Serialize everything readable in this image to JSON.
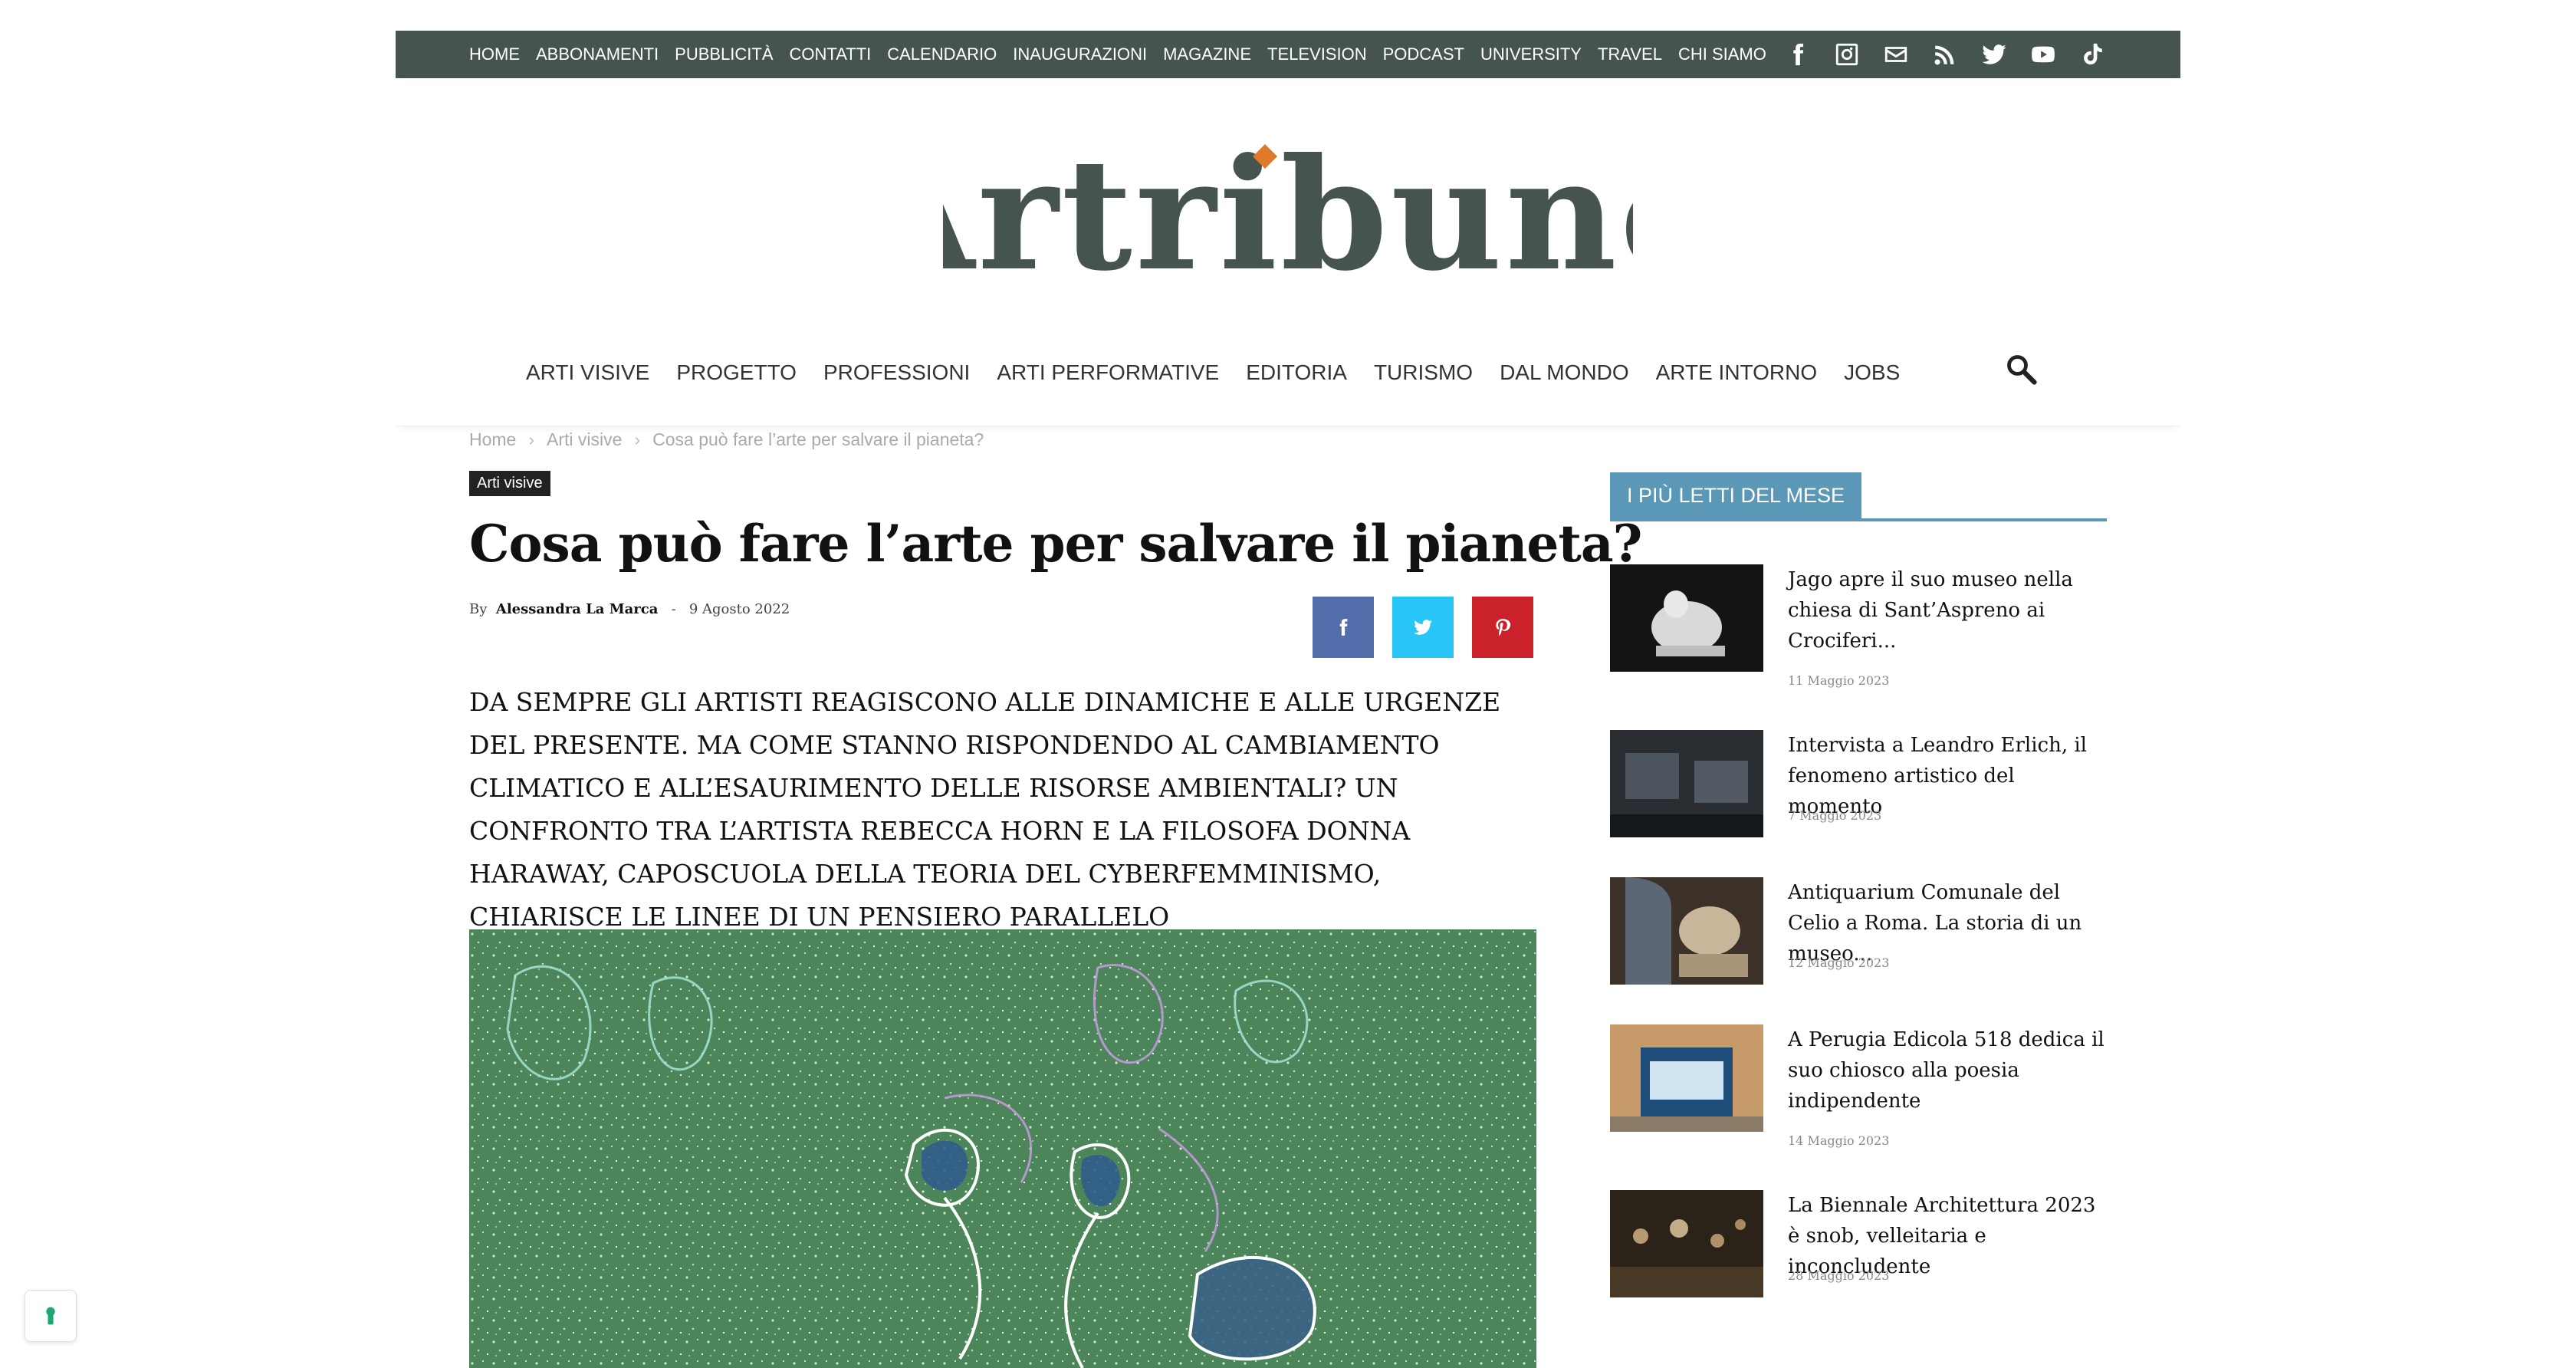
{
  "topbar": {
    "links": [
      "HOME",
      "ABBONAMENTI",
      "PUBBLICITÀ",
      "CONTATTI",
      "CALENDARIO",
      "INAUGURAZIONI",
      "MAGAZINE",
      "TELEVISION",
      "PODCAST",
      "UNIVERSITY",
      "TRAVEL",
      "CHI SIAMO"
    ],
    "social_icons": [
      "facebook-icon",
      "instagram-icon",
      "mail-icon",
      "rss-icon",
      "twitter-icon",
      "youtube-icon",
      "tiktok-icon"
    ]
  },
  "logo": {
    "text": "Artribune",
    "accent_color": "#e07a2a",
    "color": "#46544f"
  },
  "mainnav": {
    "items": [
      "ARTI VISIVE",
      "PROGETTO",
      "PROFESSIONI",
      "ARTI PERFORMATIVE",
      "EDITORIA",
      "TURISMO",
      "DAL MONDO",
      "ARTE INTORNO",
      "JOBS"
    ],
    "search_icon": "search-icon"
  },
  "breadcrumb": {
    "items": [
      "Home",
      "Arti visive",
      "Cosa può fare l’arte per salvare il pianeta?"
    ],
    "separator": "›"
  },
  "article": {
    "category": "Arti visive",
    "title": "Cosa può fare l’arte per salvare il pianeta?",
    "by": "By",
    "author": "Alessandra La Marca",
    "dash": "-",
    "date": "9 Agosto 2022",
    "intro": "DA SEMPRE GLI ARTISTI REAGISCONO ALLE DINAMICHE E ALLE URGENZE DEL PRESENTE. MA COME STANNO RISPONDENDO AL CAMBIAMENTO CLIMATICO E ALL’ESAURIMENTO DELLE RISORSE AMBIENTALI? UN CONFRONTO TRA L’ARTISTA REBECCA HORN E LA FILOSOFA DONNA HARAWAY, CAPOSCUOLA DELLA TEORIA DEL CYBERFEMMINISMO, CHIARISCE LE LINEE DI UN PENSIERO PARALLELO",
    "share": [
      {
        "icon": "facebook-icon",
        "color": "#516eab"
      },
      {
        "icon": "twitter-icon",
        "color": "#29c5f6"
      },
      {
        "icon": "pinterest-icon",
        "color": "#ca212a"
      }
    ]
  },
  "sidebar": {
    "heading": "I PIÙ LETTI DEL MESE",
    "accent": "#5b97b7",
    "posts": [
      {
        "title": "Jago apre il suo museo nella chiesa di Sant’Aspreno ai Crociferi...",
        "date": "11 Maggio 2023"
      },
      {
        "title": "Intervista a Leandro Erlich, il fenomeno artistico del momento",
        "date": "7 Maggio 2023"
      },
      {
        "title": "Antiquarium Comunale del Celio a Roma. La storia di un museo...",
        "date": "12 Maggio 2023"
      },
      {
        "title": "A Perugia Edicola 518 dedica il suo chiosco alla poesia indipendente",
        "date": "14 Maggio 2023"
      },
      {
        "title": "La Biennale Architettura 2023 è snob, velleitaria e inconcludente",
        "date": "28 Maggio 2023"
      }
    ]
  }
}
